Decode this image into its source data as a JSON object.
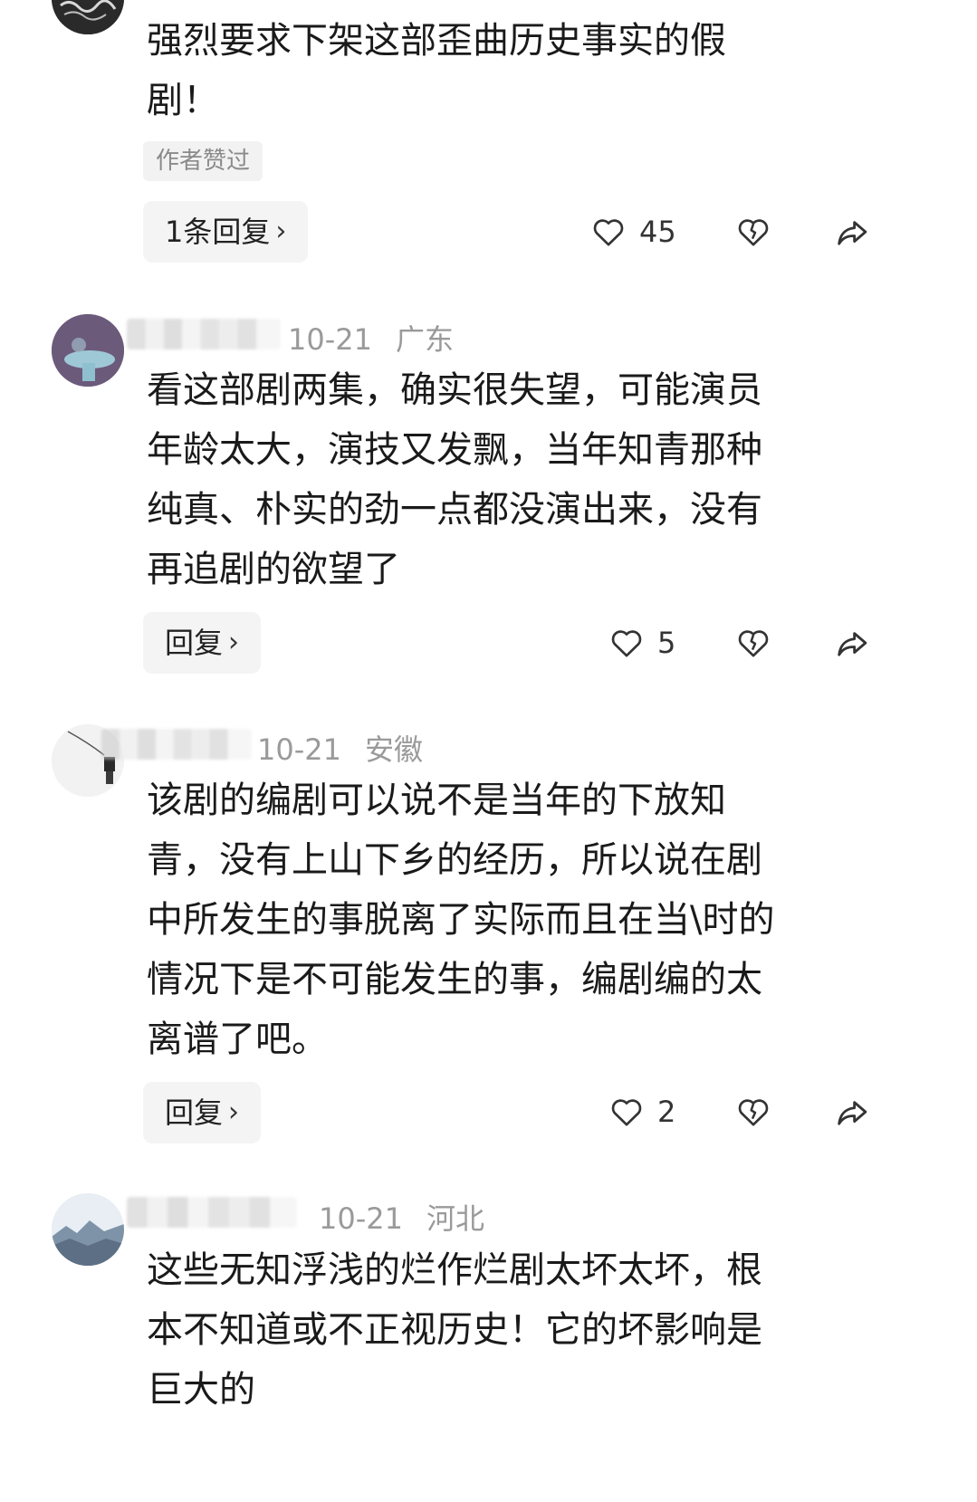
{
  "comments": [
    {
      "content": "强烈要求下架这部歪曲历史事实的假\n剧！",
      "tag": "作者赞过",
      "reply_label": "1条回复",
      "likes": "45"
    },
    {
      "date": "10-21",
      "location": "广东",
      "content": "看这部剧两集，确实很失望，可能演员\n年龄太大，演技又发飘，当年知青那种\n纯真、朴实的劲一点都没演出来，没有\n再追剧的欲望了",
      "reply_label": "回复",
      "likes": "5"
    },
    {
      "date": "10-21",
      "location": "安徽",
      "content": "该剧的编剧可以说不是当年的下放知\n青，没有上山下乡的经历，所以说在剧\n中所发生的事脱离了实际而且在当\\时的\n情况下是不可能发生的事，编剧编的太\n离谱了吧。",
      "reply_label": "回复",
      "likes": "2"
    },
    {
      "date": "10-21",
      "location": "河北",
      "content": "这些无知浮浅的烂作烂剧太坏太坏，根\n本不知道或不正视历史！它的坏影响是\n巨大的"
    }
  ],
  "icons": {
    "like": "heart-outline-icon",
    "dislike": "broken-heart-icon",
    "share": "share-arrow-icon",
    "reply_chevron": "chevron-right-icon"
  }
}
